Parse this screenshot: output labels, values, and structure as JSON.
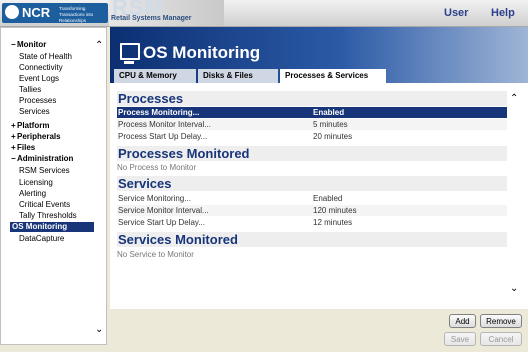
{
  "brand": {
    "ncr_name": "NCR",
    "ncr_tagline": "Transforming Transactions into Relationships",
    "app_name": "RSM",
    "app_subtitle": "Retail Systems Manager"
  },
  "topnav": {
    "user": "User",
    "help": "Help"
  },
  "sidebar": {
    "items": [
      {
        "label": "Monitor",
        "type": "category",
        "toggle": "−"
      },
      {
        "label": "State of Health",
        "type": "item"
      },
      {
        "label": "Connectivity",
        "type": "item"
      },
      {
        "label": "Event Logs",
        "type": "item"
      },
      {
        "label": "Tallies",
        "type": "item"
      },
      {
        "label": "Processes",
        "type": "item"
      },
      {
        "label": "Services",
        "type": "item"
      },
      {
        "label": "Platform",
        "type": "category",
        "toggle": "+"
      },
      {
        "label": "Peripherals",
        "type": "category",
        "toggle": "+"
      },
      {
        "label": "Files",
        "type": "category",
        "toggle": "+"
      },
      {
        "label": "Administration",
        "type": "category",
        "toggle": "−"
      },
      {
        "label": "RSM Services",
        "type": "item"
      },
      {
        "label": "Licensing",
        "type": "item"
      },
      {
        "label": "Alerting",
        "type": "item"
      },
      {
        "label": "Critical Events",
        "type": "item"
      },
      {
        "label": "Tally Thresholds",
        "type": "item"
      },
      {
        "label": "OS Monitoring",
        "type": "selected"
      },
      {
        "label": "DataCapture",
        "type": "item"
      }
    ]
  },
  "header": {
    "title": "OS Monitoring"
  },
  "tabs": [
    {
      "label": "CPU & Memory"
    },
    {
      "label": "Disks & Files"
    },
    {
      "label": "Processes & Services"
    }
  ],
  "sections": {
    "processes": {
      "title": "Processes",
      "rows": [
        {
          "key": "Process Monitoring...",
          "value": "Enabled"
        },
        {
          "key": "Process Monitor Interval...",
          "value": "5 minutes"
        },
        {
          "key": "Process Start Up Delay...",
          "value": "20 minutes"
        }
      ]
    },
    "processes_monitored": {
      "title": "Processes Monitored",
      "empty": "No Process to Monitor"
    },
    "services": {
      "title": "Services",
      "rows": [
        {
          "key": "Service Monitoring...",
          "value": "Enabled"
        },
        {
          "key": "Service Monitor Interval...",
          "value": "120 minutes"
        },
        {
          "key": "Service Start Up Delay...",
          "value": "12 minutes"
        }
      ]
    },
    "services_monitored": {
      "title": "Services Monitored",
      "empty": "No Service to Monitor"
    }
  },
  "buttons": {
    "add": "Add",
    "remove": "Remove",
    "save": "Save",
    "cancel": "Cancel"
  },
  "colors": {
    "accent": "#18357a",
    "section_title": "#18357a"
  }
}
